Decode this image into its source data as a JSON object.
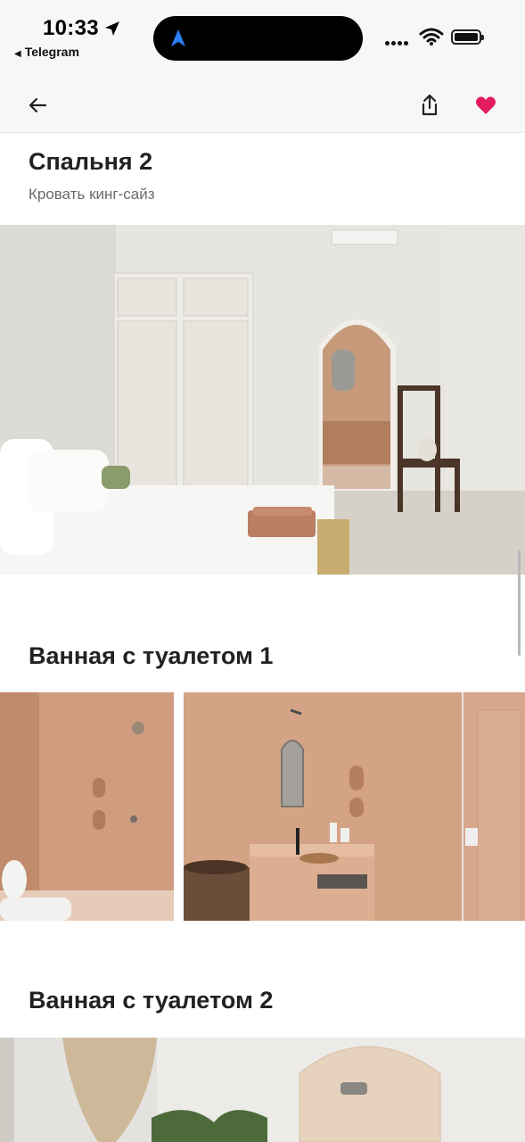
{
  "status_bar": {
    "time": "10:33",
    "back_app": "Telegram",
    "icons": [
      "location-arrow-icon",
      "navigation-icon",
      "signal-icon",
      "wifi-icon",
      "battery-icon"
    ]
  },
  "nav": {
    "back_icon": "arrow-left-icon",
    "share_icon": "share-icon",
    "favorite_icon": "heart-icon",
    "favorite_color": "#e31c5f"
  },
  "sections": [
    {
      "title": "Спальня 2",
      "subtitle": "Кровать кинг-сайз"
    },
    {
      "title": "Ванная с туалетом 1"
    },
    {
      "title": "Ванная с туалетом 2"
    }
  ]
}
